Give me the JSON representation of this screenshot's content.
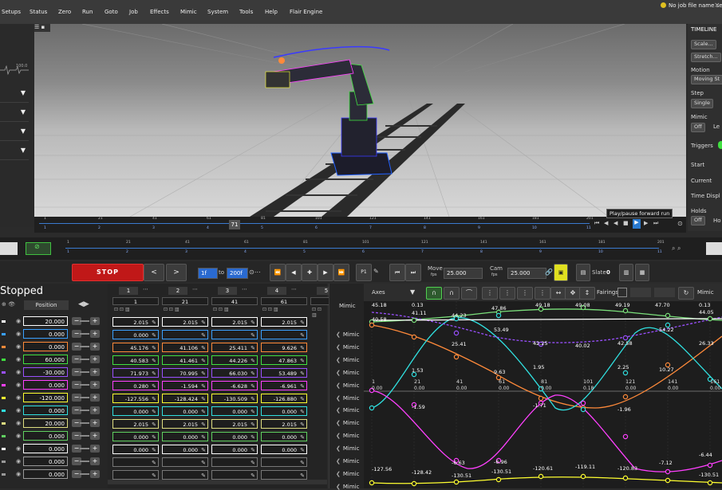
{
  "menubar": {
    "items": [
      "Setups",
      "Status",
      "Zero",
      "Run",
      "Goto",
      "Job",
      "Effects",
      "Mimic",
      "System",
      "Tools",
      "Help",
      "Flair Engine"
    ],
    "job_note": "No job file name set"
  },
  "viewport": {
    "scrub_ticks": [
      "1",
      "21",
      "41",
      "61",
      "81",
      "101",
      "121",
      "141",
      "161",
      "181",
      "201"
    ],
    "scrub_sub": [
      "1",
      "2",
      "3",
      "4",
      "5",
      "6",
      "7",
      "8",
      "9",
      "10",
      "11"
    ],
    "current_frame": "71",
    "tooltip": "Play/pause forward run"
  },
  "leftpanel": {
    "value": "100.0"
  },
  "rightpanel": {
    "title": "TIMELINE",
    "scale": "Scale...",
    "stretch": "Stretch...",
    "motion_label": "Motion",
    "motion_value": "Moving St",
    "step_label": "Step",
    "step_value": "Single",
    "mimic_label": "Mimic",
    "mimic_value": "Off",
    "mimic_extra": "Le",
    "triggers_label": "Triggers",
    "start_label": "Start",
    "current_label": "Current",
    "time_display_label": "Time Displ",
    "holds_label": "Holds",
    "holds_value": "Off",
    "holds_extra": "Ho"
  },
  "trackbar": {
    "ticks": [
      "1",
      "21",
      "41",
      "61",
      "81",
      "101",
      "121",
      "141",
      "161",
      "181",
      "201"
    ],
    "sub": [
      "1",
      "2",
      "3",
      "4",
      "5",
      "6",
      "7",
      "8",
      "9",
      "10",
      "11"
    ]
  },
  "controls": {
    "stop": "STOP",
    "prev": "<",
    "next": ">",
    "from_frame": "1f",
    "to_label": "to",
    "to_frame": "200f",
    "p1": "P1",
    "move_label": "Move",
    "move_value": "25.000",
    "move_unit": "fps",
    "cam_label": "Cam",
    "cam_value": "25.000",
    "cam_unit": "fps",
    "slate_label": "Slate",
    "slate_value": "0"
  },
  "axes": {
    "status": "Stopped",
    "position_label": "Position",
    "rows": [
      {
        "value": "20.000",
        "color": "#ffffff"
      },
      {
        "value": "0.000",
        "color": "#3aa0ff"
      },
      {
        "value": "0.000",
        "color": "#ff8a3a"
      },
      {
        "value": "60.000",
        "color": "#40e040"
      },
      {
        "value": "-30.000",
        "color": "#9a50ff"
      },
      {
        "value": "0.000",
        "color": "#ff40ff"
      },
      {
        "value": "-120.000",
        "color": "#ffff30"
      },
      {
        "value": "0.000",
        "color": "#30e0e0"
      },
      {
        "value": "20.000",
        "color": "#dddd80"
      },
      {
        "value": "0.000",
        "color": "#60d060"
      },
      {
        "value": "0.000",
        "color": "#ffffff"
      },
      {
        "value": "0.000",
        "color": "#999999"
      },
      {
        "value": "0.000",
        "color": "#999999"
      }
    ]
  },
  "keyframes": {
    "columns": [
      {
        "index": "1",
        "frame": "1"
      },
      {
        "index": "2",
        "frame": "21"
      },
      {
        "index": "3",
        "frame": "41"
      },
      {
        "index": "4",
        "frame": "61"
      },
      {
        "index": "5",
        "frame": "8"
      }
    ],
    "rows": [
      [
        "2.015",
        "2.015",
        "2.015",
        "2.015"
      ],
      [
        "0.000",
        "",
        "",
        ""
      ],
      [
        "45.176",
        "41.106",
        "25.411",
        "9.626"
      ],
      [
        "40.583",
        "41.461",
        "44.226",
        "47.863"
      ],
      [
        "71.973",
        "70.995",
        "66.030",
        "53.489"
      ],
      [
        "0.280",
        "-1.594",
        "-6.628",
        "-6.961"
      ],
      [
        "-127.556",
        "-128.424",
        "-130.509",
        "-126.880"
      ],
      [
        "0.000",
        "0.000",
        "0.000",
        "0.000"
      ],
      [
        "2.015",
        "2.015",
        "2.015",
        "2.015"
      ],
      [
        "0.000",
        "0.000",
        "0.000",
        "0.000"
      ],
      [
        "0.000",
        "0.000",
        "0.000",
        "0.000"
      ],
      [
        "",
        "",
        "",
        ""
      ],
      [
        "",
        "",
        "",
        ""
      ]
    ],
    "mimic_header": "Mimic",
    "mimic_label": "Mimic"
  },
  "curves": {
    "axes_label": "Axes",
    "fairings_label": "Fairings",
    "mimic_label": "Mimic",
    "x_labels": [
      "1",
      "21",
      "41",
      "61",
      "81",
      "101",
      "121",
      "141",
      "161"
    ],
    "x_sub": [
      "0.00",
      "0.00",
      "0.00",
      "0.00",
      "0.00",
      "0.18",
      "0.00",
      "0.00",
      "0.00"
    ],
    "point_labels": [
      {
        "t": "45.18",
        "c": "#ffffff"
      },
      {
        "t": "40.58",
        "c": "#ffffff"
      },
      {
        "t": "0.13",
        "c": "#ffffff"
      },
      {
        "t": "41.11",
        "c": "#ffffff"
      },
      {
        "t": "44.23",
        "c": "#ffffff"
      },
      {
        "t": "47.86",
        "c": "#ffffff"
      },
      {
        "t": "49.18",
        "c": "#ffffff"
      },
      {
        "t": "49.08",
        "c": "#ffffff"
      },
      {
        "t": "49.19",
        "c": "#ffffff"
      },
      {
        "t": "47.70",
        "c": "#ffffff"
      },
      {
        "t": "44.05",
        "c": "#ffffff"
      },
      {
        "t": "0.13",
        "c": "#ffffff"
      },
      {
        "t": "25.41",
        "c": "#ffffff"
      },
      {
        "t": "53.49",
        "c": "#ffffff"
      },
      {
        "t": "42.25",
        "c": "#ffffff"
      },
      {
        "t": "40.02",
        "c": "#ffffff"
      },
      {
        "t": "42.58",
        "c": "#ffffff"
      },
      {
        "t": "54.22",
        "c": "#ffffff"
      },
      {
        "t": "26.33",
        "c": "#ffffff"
      },
      {
        "t": "1.53",
        "c": "#ffffff"
      },
      {
        "t": "9.63",
        "c": "#ffffff"
      },
      {
        "t": "1.95",
        "c": "#ffffff"
      },
      {
        "t": "2.25",
        "c": "#ffffff"
      },
      {
        "t": "10.27",
        "c": "#ffffff"
      },
      {
        "t": "-1.59",
        "c": "#ffffff"
      },
      {
        "t": "-1.71",
        "c": "#ffffff"
      },
      {
        "t": "-1.96",
        "c": "#ffffff"
      },
      {
        "t": "-6.63",
        "c": "#ffffff"
      },
      {
        "t": "-6.96",
        "c": "#ffffff"
      },
      {
        "t": "-7.12",
        "c": "#ffffff"
      },
      {
        "t": "-6.44",
        "c": "#ffffff"
      },
      {
        "t": "-127.56",
        "c": "#ffffff"
      },
      {
        "t": "-128.42",
        "c": "#ffffff"
      },
      {
        "t": "-130.51",
        "c": "#ffffff"
      },
      {
        "t": "-120.61",
        "c": "#ffffff"
      },
      {
        "t": "-119.11",
        "c": "#ffffff"
      },
      {
        "t": "-120.83",
        "c": "#ffffff"
      },
      {
        "t": "-130.51",
        "c": "#ffffff"
      },
      {
        "t": "-130.51",
        "c": "#ffffff"
      }
    ]
  }
}
